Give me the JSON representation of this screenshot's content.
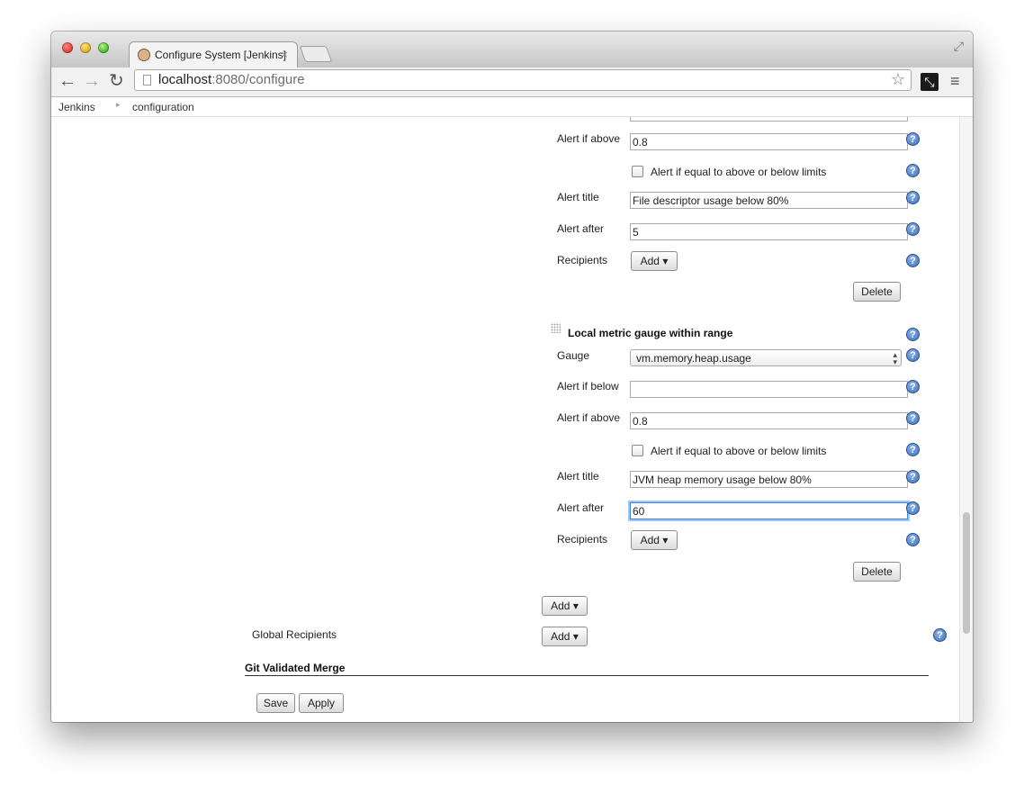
{
  "browser": {
    "tab_title": "Configure System [Jenkins]",
    "tab_close": "×",
    "url_host": "localhost",
    "url_path": ":8080/configure",
    "back": "←",
    "forward": "→",
    "reload": "↻",
    "star": "☆",
    "menu": "≡",
    "fullscreen": "⤢",
    "ext": "⤡"
  },
  "breadcrumb": {
    "items": [
      "Jenkins",
      "configuration"
    ],
    "separator": "▸"
  },
  "alert1": {
    "alert_if_above_label": "Alert if above",
    "alert_if_above_value": "0.8",
    "equal_limits_label": "Alert if equal to above or below limits",
    "equal_limits_checked": false,
    "alert_title_label": "Alert title",
    "alert_title_value": "File descriptor usage below 80%",
    "alert_after_label": "Alert after",
    "alert_after_value": "5",
    "recipients_label": "Recipients",
    "add_label": "Add",
    "delete_label": "Delete"
  },
  "alert2": {
    "section_title": "Local metric gauge within range",
    "gauge_label": "Gauge",
    "gauge_value": "vm.memory.heap.usage",
    "alert_if_below_label": "Alert if below",
    "alert_if_below_value": "",
    "alert_if_above_label": "Alert if above",
    "alert_if_above_value": "0.8",
    "equal_limits_label": "Alert if equal to above or below limits",
    "equal_limits_checked": false,
    "alert_title_label": "Alert title",
    "alert_title_value": "JVM heap memory usage below 80%",
    "alert_after_label": "Alert after",
    "alert_after_value": "60",
    "recipients_label": "Recipients",
    "add_label": "Add",
    "delete_label": "Delete"
  },
  "footer": {
    "add_alert_label": "Add",
    "global_recipients_label": "Global Recipients",
    "global_add_label": "Add",
    "git_section_title": "Git Validated Merge",
    "save_label": "Save",
    "apply_label": "Apply"
  },
  "help_glyph": "?",
  "dropdown_caret": "▾",
  "colors": {
    "help_icon": "#3e72c0",
    "focus_ring": "#3b86d6"
  }
}
